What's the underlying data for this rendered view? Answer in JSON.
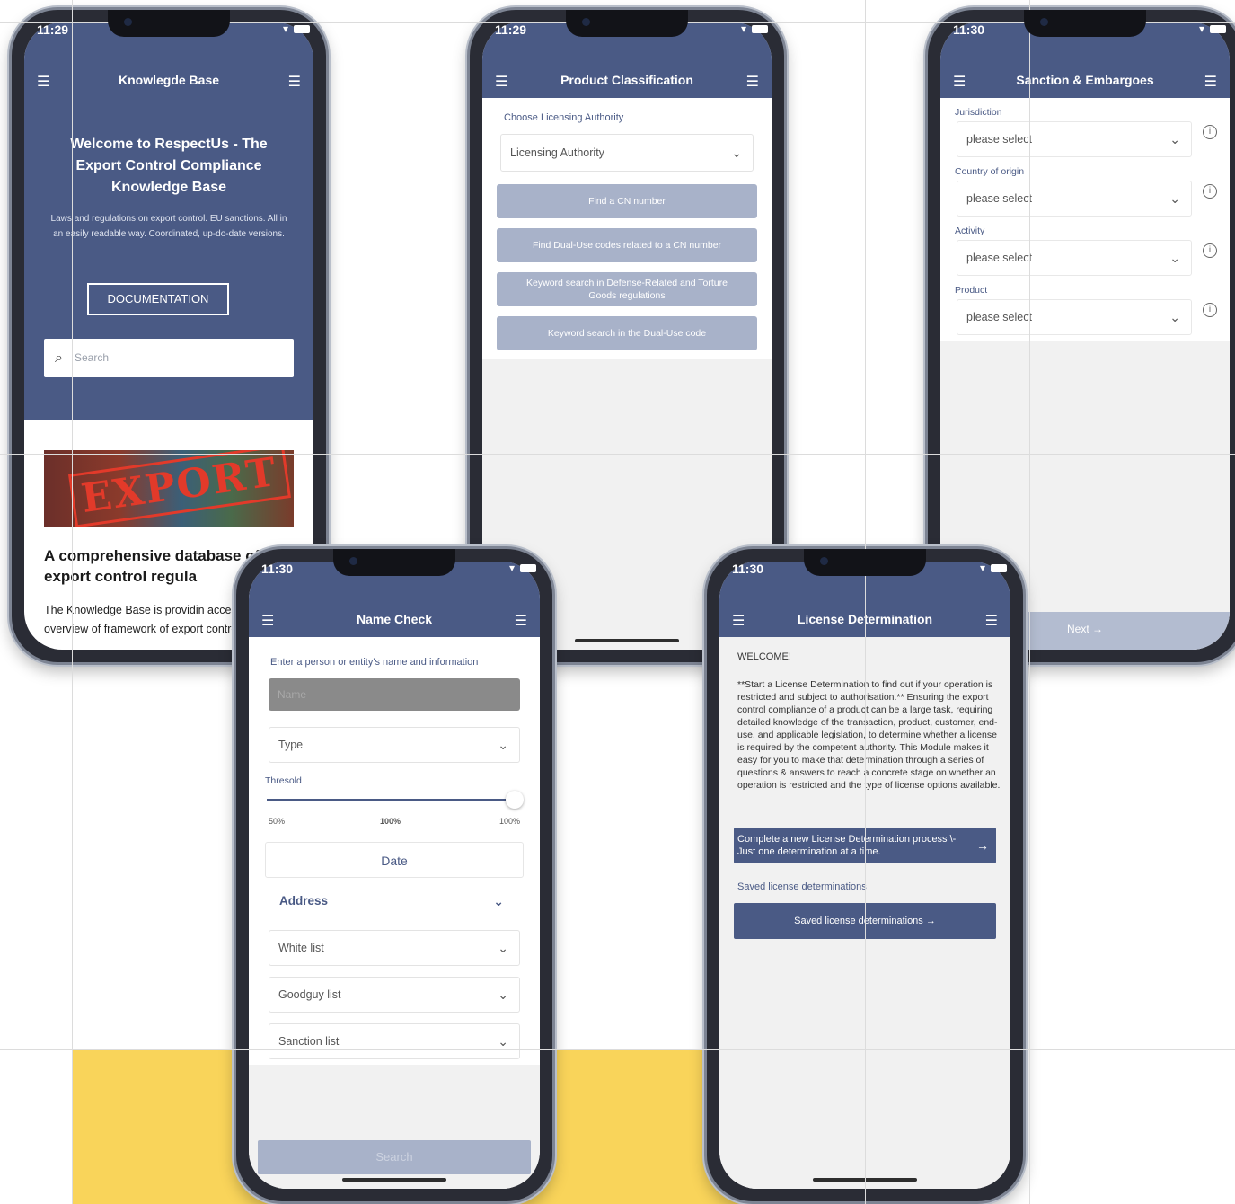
{
  "phones": {
    "kb": {
      "time": "11:29",
      "title": "Knowlegde Base",
      "hero_title": "Welcome to RespectUs - The Export Control Compliance Knowledge Base",
      "hero_sub": "Laws and regulations on export control. EU sanctions. All in an easily readable way. Coordinated, up-do-date versions.",
      "doc_button": "DOCUMENTATION",
      "search_placeholder": "Search",
      "image_text": "EXPORT",
      "h2": "A comprehensive database of export control regula",
      "p": "The Knowledge Base is providin access to a detailed overview of framework of export control com"
    },
    "pc": {
      "time": "11:29",
      "title": "Product Classification",
      "label": "Choose Licensing Authority",
      "select": "Licensing Authority",
      "buttons": [
        "Find a CN number",
        "Find Dual-Use codes related to a CN number",
        "Keyword search in Defense-Related and Torture Goods regulations",
        "Keyword search in the Dual-Use code"
      ]
    },
    "sc": {
      "time": "11:30",
      "title": "Sanction & Embargoes",
      "fields": [
        {
          "label": "Jurisdiction",
          "value": "please select"
        },
        {
          "label": "Country of origin",
          "value": "please select"
        },
        {
          "label": "Activity",
          "value": "please select"
        },
        {
          "label": "Product",
          "value": "please select"
        }
      ],
      "next": "Next"
    },
    "nc": {
      "time": "11:30",
      "title": "Name Check",
      "label": "Enter a person or entity's name and information",
      "name_placeholder": "Name",
      "type": "Type",
      "threshold_label": "Thresold",
      "threshold": 1.0,
      "ticks": [
        "50%",
        "100%",
        "100%"
      ],
      "date": "Date",
      "address": "Address",
      "lists": [
        "White list",
        "Goodguy list",
        "Sanction list"
      ],
      "search": "Search"
    },
    "ld": {
      "time": "11:30",
      "title": "License Determination",
      "welcome": "WELCOME!",
      "body": "**Start a License Determination to find out if your operation is restricted and subject to authorisation.** Ensuring the export control compliance of a product can be a large task, requiring detailed knowledge of the transaction, product, customer, end-use, and applicable legislation, to determine whether a license is required by the competent authority. This Module makes it easy for you to make that determination through a series of questions & answers to reach a concrete stage on whether an operation is restricted and the type of license options available.",
      "start_button": "Complete a new License Determination process \\- Just one determination at a time.",
      "saved_label": "Saved license determinations",
      "saved_button": "Saved license determinations"
    }
  },
  "colors": {
    "header": "#4a5a85",
    "button_disabled": "#a8b2c9",
    "background_accent": "#f9d45a"
  }
}
